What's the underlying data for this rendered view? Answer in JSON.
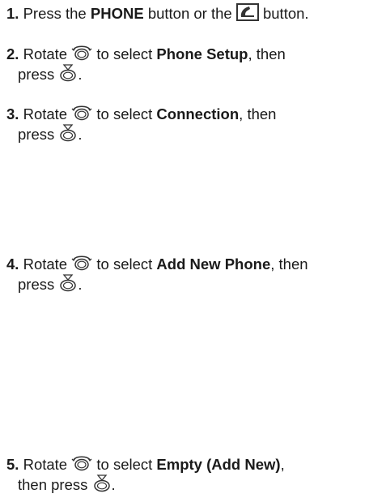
{
  "steps": [
    {
      "number": "1.",
      "t1": "Press the",
      "b1": "PHONE",
      "t2": "button or the",
      "t3": "button.",
      "icon": "phone-button-icon"
    },
    {
      "number": "2.",
      "t1": "Rotate",
      "t2": "to select",
      "b1": "Phone Setup",
      "t3": ", then",
      "t4": "press",
      "t5": ".",
      "icons": [
        "rotate-knob-icon",
        "press-knob-icon"
      ]
    },
    {
      "number": "3.",
      "t1": "Rotate",
      "t2": "to select",
      "b1": "Connection",
      "t3": ", then",
      "t4": "press",
      "t5": ".",
      "icons": [
        "rotate-knob-icon",
        "press-knob-icon"
      ]
    },
    {
      "number": "4.",
      "t1": "Rotate",
      "t2": "to select",
      "b1": "Add New Phone",
      "t3": ", then",
      "t4": "press",
      "t5": ".",
      "icons": [
        "rotate-knob-icon",
        "press-knob-icon"
      ]
    },
    {
      "number": "5.",
      "t1": "Rotate",
      "t2": "to select",
      "b1": "Empty (Add New)",
      "t3": ",",
      "t4": "then press",
      "t5": ".",
      "icons": [
        "rotate-knob-icon",
        "press-knob-icon"
      ]
    }
  ],
  "colors": {
    "text": "#1a1a1a",
    "icon_stroke": "#333333"
  }
}
